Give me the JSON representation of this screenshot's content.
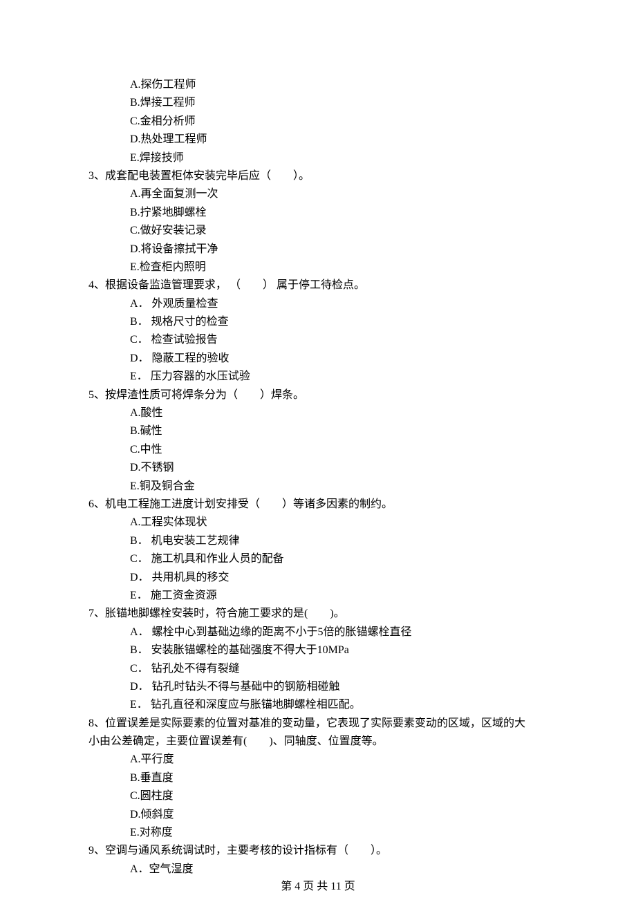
{
  "q2": {
    "options": {
      "A": "A.探伤工程师",
      "B": "B.焊接工程师",
      "C": "C.金相分析师",
      "D": "D.热处理工程师",
      "E": "E.焊接技师"
    }
  },
  "q3": {
    "stem": "3、成套配电装置柜体安装完毕后应（　　）。",
    "options": {
      "A": "A.再全面复测一次",
      "B": "B.拧紧地脚螺栓",
      "C": "C.做好安装记录",
      "D": "D.将设备擦拭干净",
      "E": "E.检查柜内照明"
    }
  },
  "q4": {
    "stem": "4、根据设备监造管理要求，  （　　）  属于停工待检点。",
    "options": {
      "A": "A． 外观质量检查",
      "B": "B． 规格尺寸的检查",
      "C": "C． 检查试验报告",
      "D": "D． 隐蔽工程的验收",
      "E": "E． 压力容器的水压试验"
    }
  },
  "q5": {
    "stem": "5、按焊渣性质可将焊条分为（　　）焊条。",
    "options": {
      "A": "A.酸性",
      "B": "B.碱性",
      "C": "C.中性",
      "D": "D.不锈钢",
      "E": "E.铜及铜合金"
    }
  },
  "q6": {
    "stem": "6、机电工程施工进度计划安排受（　　）等诸多因素的制约。",
    "options": {
      "A": "A.工程实体现状",
      "B": "B． 机电安装工艺规律",
      "C": "C． 施工机具和作业人员的配备",
      "D": "D． 共用机具的移交",
      "E": "E． 施工资金资源"
    }
  },
  "q7": {
    "stem": "7、胀锚地脚螺栓安装时，符合施工要求的是(　　)。",
    "options": {
      "A": "A． 螺栓中心到基础边缘的距离不小于5倍的胀锚螺栓直径",
      "B": "B． 安装胀锚螺栓的基础强度不得大于10MPa",
      "C": "C． 钻孔处不得有裂缝",
      "D": "D． 钻孔时钻头不得与基础中的钢筋相碰触",
      "E": "E． 钻孔直径和深度应与胀锚地脚螺栓相匹配。"
    }
  },
  "q8": {
    "stem_line1": "8、位置误差是实际要素的位置对基准的变动量，它表现了实际要素变动的区域，区域的大",
    "stem_line2": "小由公差确定，主要位置误差有(　　)、同轴度、位置度等。",
    "options": {
      "A": "A.平行度",
      "B": "B.垂直度",
      "C": "C.圆柱度",
      "D": "D.倾斜度",
      "E": "E.对称度"
    }
  },
  "q9": {
    "stem": "9、空调与通风系统调试时，主要考核的设计指标有（　　）。",
    "options": {
      "A": "A．空气湿度"
    }
  },
  "footer": "第 4 页 共 11 页"
}
